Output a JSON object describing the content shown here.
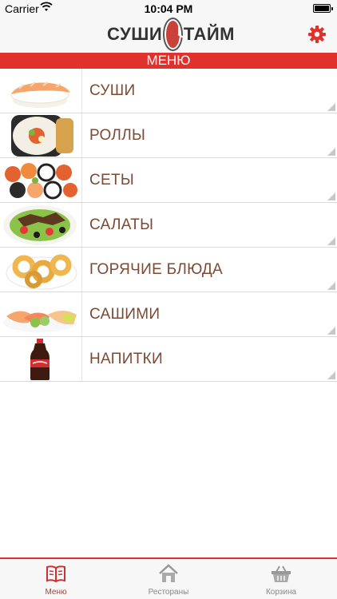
{
  "status_bar": {
    "carrier": "Carrier",
    "time": "10:04 PM"
  },
  "header": {
    "logo_left": "СУШИ",
    "logo_right": "ТАЙМ",
    "settings_icon": "gear-icon",
    "accent_color": "#e0312d"
  },
  "menu_banner": "МЕНЮ",
  "menu_items": [
    {
      "label": "СУШИ",
      "image": "sushi-image"
    },
    {
      "label": "РОЛЛЫ",
      "image": "rolls-image"
    },
    {
      "label": "СЕТЫ",
      "image": "sets-image"
    },
    {
      "label": "САЛАТЫ",
      "image": "salads-image"
    },
    {
      "label": "ГОРЯЧИЕ БЛЮДА",
      "image": "hot-dishes-image"
    },
    {
      "label": "САШИМИ",
      "image": "sashimi-image"
    },
    {
      "label": "НАПИТКИ",
      "image": "drinks-image"
    }
  ],
  "tab_bar": {
    "tabs": [
      {
        "label": "Меню",
        "icon": "book-icon",
        "active": true
      },
      {
        "label": "Рестораны",
        "icon": "house-icon",
        "active": false
      },
      {
        "label": "Корзина",
        "icon": "basket-icon",
        "active": false
      }
    ]
  }
}
